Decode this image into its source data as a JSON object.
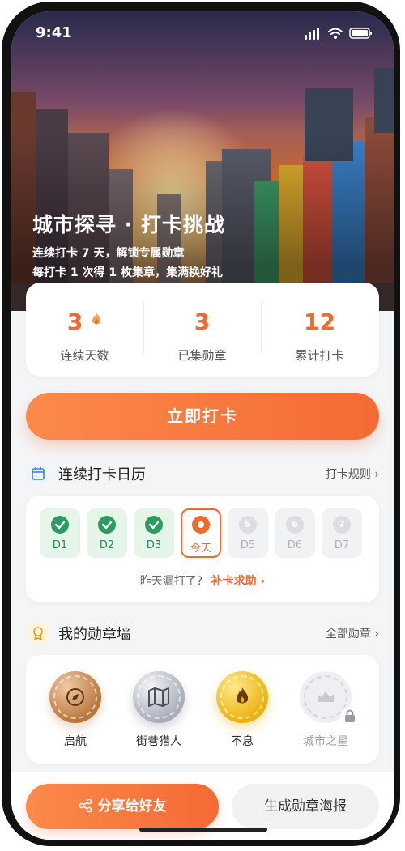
{
  "status_bar": {
    "time": "9:41"
  },
  "hero": {
    "title": "城市探寻 · 打卡挑战",
    "line1": "连续打卡 7 天，解锁专属勋章",
    "line2": "每打卡 1 次得 1 枚集章，集满换好礼"
  },
  "stats": [
    {
      "value": "3",
      "label": "连续天数",
      "icon": "flame-icon"
    },
    {
      "value": "3",
      "label": "已集勋章"
    },
    {
      "value": "12",
      "label": "累计打卡"
    }
  ],
  "cta_label": "立即打卡",
  "calendar": {
    "title": "连续打卡日历",
    "link": "打卡规则 ›",
    "icon": "calendar-icon",
    "days": [
      {
        "label": "D1",
        "state": "done",
        "num": ""
      },
      {
        "label": "D2",
        "state": "done",
        "num": ""
      },
      {
        "label": "D3",
        "state": "done",
        "num": ""
      },
      {
        "label": "今天",
        "state": "today",
        "num": ""
      },
      {
        "label": "D5",
        "state": "future",
        "num": "5"
      },
      {
        "label": "D6",
        "state": "future",
        "num": "6"
      },
      {
        "label": "D7",
        "state": "future",
        "num": "7"
      }
    ],
    "missed_text": "昨天漏打了?",
    "rescue_link": "补卡求助 ›"
  },
  "badges": {
    "title": "我的勋章墙",
    "link": "全部勋章 ›",
    "icon": "medal-icon",
    "items": [
      {
        "name": "启航",
        "icon": "compass-icon",
        "locked": false
      },
      {
        "name": "街巷猎人",
        "icon": "map-icon",
        "locked": false
      },
      {
        "name": "不息",
        "icon": "flame-icon",
        "locked": false
      },
      {
        "name": "城市之星",
        "icon": "crown-icon",
        "locked": true
      }
    ]
  },
  "actions": {
    "share_label": "分享给好友",
    "poster_label": "生成勋章海报"
  },
  "colors": {
    "accent": "#f26a2c",
    "success": "#2e9b5e"
  }
}
